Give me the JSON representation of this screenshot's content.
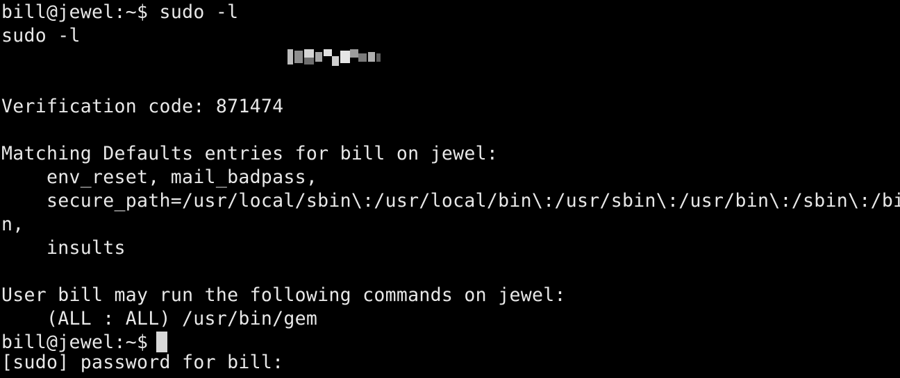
{
  "terminal": {
    "lines": [
      "bill@jewel:~$ sudo -l",
      "sudo -l",
      "[sudo] password for bill:",
      "",
      "Verification code: 871474",
      "",
      "Matching Defaults entries for bill on jewel:",
      "env_reset, mail_badpass,",
      "secure_path=/usr/local/sbin\\:/usr/local/bin\\:/usr/sbin\\:/usr/bin\\:/sbin\\:/bi",
      "n,",
      "insults",
      "",
      "User bill may run the following commands on jewel:",
      "(ALL : ALL) /usr/bin/gem",
      "bill@jewel:~$"
    ],
    "colors": {
      "background": "#000000",
      "text": "#e8e8e8",
      "cursor": "#d9d9d9"
    }
  }
}
